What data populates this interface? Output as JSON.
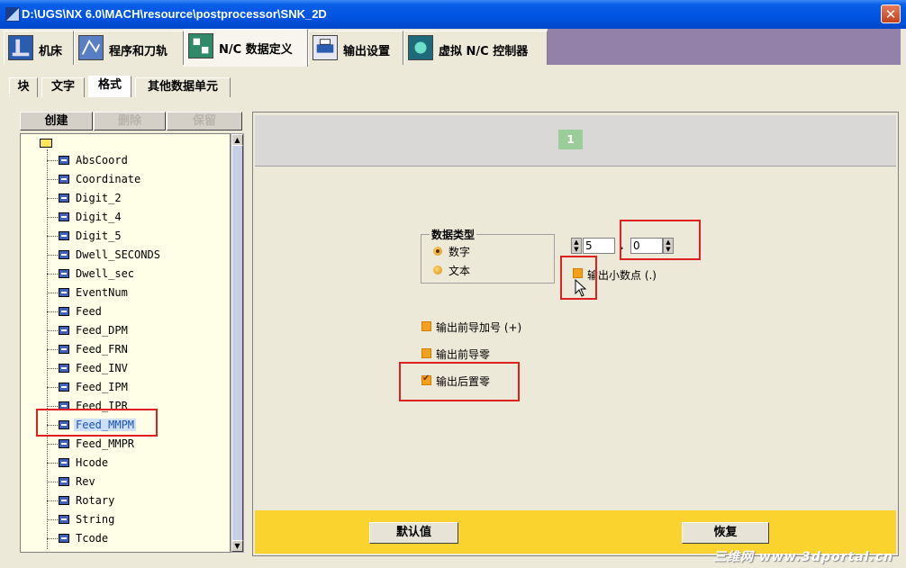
{
  "window": {
    "title": "D:\\UGS\\NX 6.0\\MACH\\resource\\postprocessor\\SNK_2D",
    "close_label": "✕"
  },
  "main_tabs": [
    {
      "label": "机床"
    },
    {
      "label": "程序和刀轨"
    },
    {
      "label": "N/C 数据定义",
      "active": true
    },
    {
      "label": "输出设置"
    },
    {
      "label": "虚拟 N/C 控制器"
    }
  ],
  "sub_tabs": [
    {
      "label": "块"
    },
    {
      "label": "文字"
    },
    {
      "label": "格式",
      "active": true
    },
    {
      "label": "其他数据单元"
    }
  ],
  "tree_toolbar": {
    "create": "创建",
    "delete": "删除",
    "keep": "保留"
  },
  "tree": {
    "items": [
      "AbsCoord",
      "Coordinate",
      "Digit_2",
      "Digit_4",
      "Digit_5",
      "Dwell_SECONDS",
      "Dwell_sec",
      "EventNum",
      "Feed",
      "Feed_DPM",
      "Feed_FRN",
      "Feed_INV",
      "Feed_IPM",
      "Feed_IPR",
      "Feed_MMPM",
      "Feed_MMPR",
      "Hcode",
      "Rev",
      "Rotary",
      "String",
      "Tcode"
    ],
    "selected": "Feed_MMPM"
  },
  "format_panel": {
    "page_number": "1",
    "data_type_title": "数据类型",
    "radio_number": "数字",
    "radio_text": "文本",
    "integer_digits": "5",
    "decimal_separator": ".",
    "fraction_digits": "0",
    "output_decimal_point": "输出小数点 (.)",
    "output_leading_plus": "输出前导加号 (+)",
    "output_leading_zero": "输出前导零",
    "output_trailing_zero": "输出后置零"
  },
  "buttons": {
    "default": "默认值",
    "restore": "恢复"
  },
  "watermark": "三维网 www.3dportal.cn",
  "colors": {
    "title_blue": "#0054e3",
    "tab_strip_purple": "#9481aa",
    "bottom_bar_yellow": "#fbd32e",
    "highlight_red": "#e02020"
  }
}
